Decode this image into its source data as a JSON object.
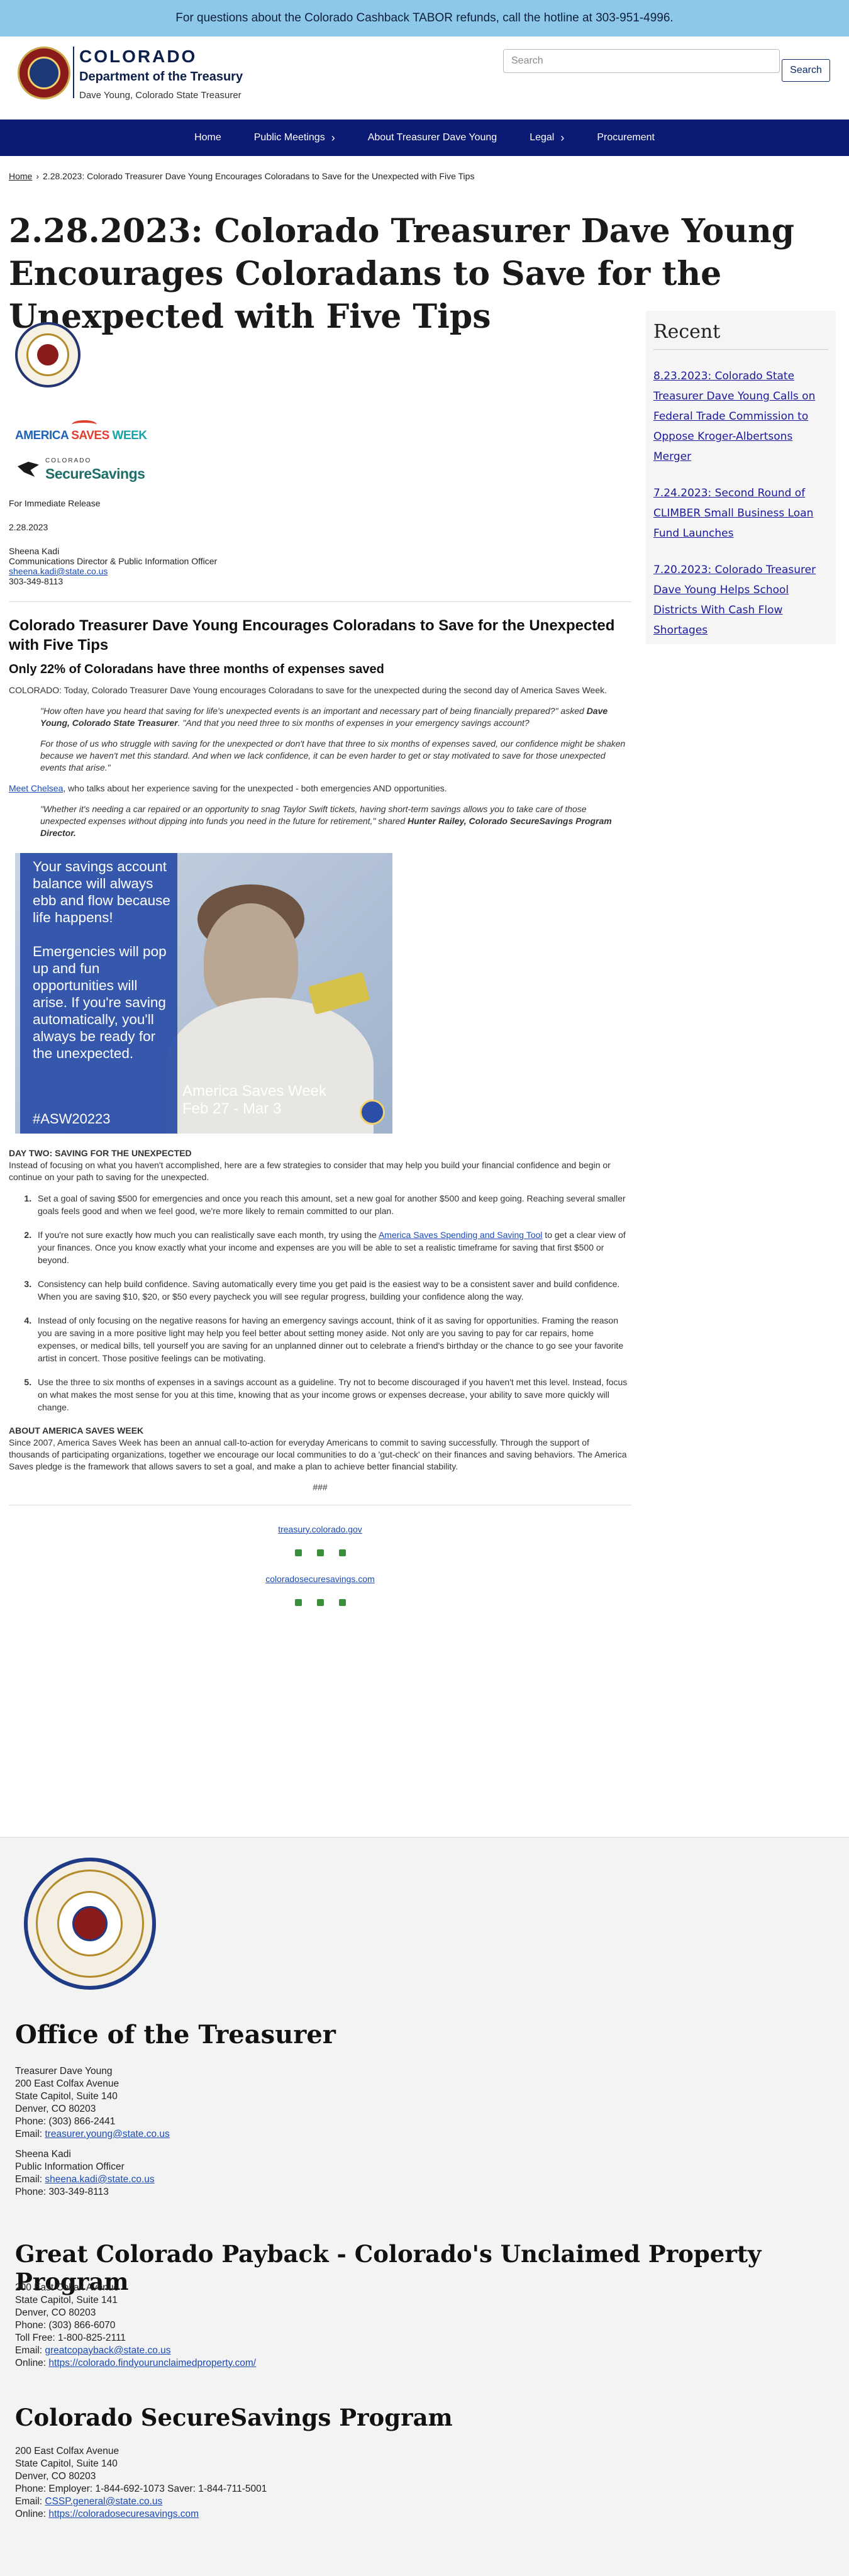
{
  "alert": {
    "text": "For questions about the Colorado Cashback TABOR refunds, call the hotline at 303-951-4996."
  },
  "brand": {
    "state": "COLORADO",
    "dept": "Department of the Treasury",
    "sub": "Dave Young, Colorado State Treasurer"
  },
  "search": {
    "placeholder": "Search",
    "button": "Search"
  },
  "nav": {
    "items": [
      "Home",
      "Public Meetings",
      "About Treasurer Dave Young",
      "Legal",
      "Procurement"
    ],
    "chevron": "›"
  },
  "breadcrumb": {
    "home": "Home",
    "separator": "›",
    "current": "2.28.2023: Colorado Treasurer Dave Young Encourages Coloradans to Save for the Unexpected with Five Tips"
  },
  "page": {
    "title": "2.28.2023: Colorado Treasurer Dave Young Encourages Coloradans to Save for the Unexpected with Five Tips"
  },
  "logos": {
    "asw_a": "AMERICA",
    "asw_b": " SAVES ",
    "asw_c": "WEEK",
    "css_top": "COLORADO",
    "css_main": "SecureSavings"
  },
  "release": {
    "label": "For Immediate Release",
    "date": "2.28.2023",
    "contact_name": "Sheena Kadi",
    "contact_title": "Communications Director & Public Information Officer",
    "contact_email": "sheena.kadi@state.co.us",
    "contact_phone": "303-349-8113"
  },
  "article": {
    "heading": "Colorado Treasurer Dave Young Encourages Coloradans to Save for the Unexpected with Five Tips",
    "subheading": "Only 22% of Coloradans have three months of expenses saved",
    "intro": "COLORADO: Today, Colorado Treasurer Dave Young encourages Coloradans to save for the unexpected during the second day of America Saves Week.",
    "quote1_text": "\"How often have you heard that saving for life's unexpected events is an important and necessary part of being financially prepared?\" asked ",
    "quote1_name": "Dave Young, Colorado State Treasurer",
    "quote1_after": ". \"And that you need three to six months of expenses in your emergency savings account?",
    "quote2": "For those of us who struggle with saving for the unexpected or don't have that three to six months of expenses saved, our confidence might be shaken because we haven't met this standard. And when we lack confidence, it can be even harder to get or stay motivated to save for those unexpected events that arise.\"",
    "chelsea_link": "Meet Chelsea",
    "chelsea_text": ", who talks about her experience saving for the unexpected - both emergencies AND opportunities.",
    "quote3_text": "\"Whether it's needing a car repaired or an opportunity to snag Taylor Swift tickets, having short-term savings allows you to take care of those unexpected expenses without dipping into funds you need in the future for retirement,\" shared ",
    "quote3_name": "Hunter Railey, Colorado SecureSavings Program Director.",
    "promo_msg1": "Your savings account balance will always ebb and flow because life happens!",
    "promo_msg2": "Emergencies will pop up and fun opportunities will arise. If you're saving automatically, you'll always be ready for the unexpected.",
    "promo_tag": "#ASW20223",
    "promo_asw": "America Saves Week",
    "promo_dates": "Feb 27 - Mar 3",
    "day_two_heading": "DAY TWO: SAVING FOR THE UNEXPECTED",
    "day_two_text": "Instead of focusing on what you haven't accomplished, here are a few strategies to consider that may help you build your financial confidence and begin or continue on your path to saving for the unexpected.",
    "tip1": "Set a goal of saving $500 for emergencies and once you reach this amount, set a new goal for another $500 and keep going. Reaching several smaller goals feels good and when we feel good, we're more likely to remain committed to our plan.",
    "tip2_a": "If you're not sure exactly how much you can realistically save each month, try using the ",
    "tip2_link": "America Saves Spending and Saving Tool",
    "tip2_b": " to get a clear view of your finances. Once you know exactly what your income and expenses are you will be able to set a realistic timeframe for saving that first $500 or beyond.",
    "tip3": "Consistency can help build confidence. Saving automatically every time you get paid is the easiest way to be a consistent saver and build confidence. When you are saving $10, $20, or $50 every paycheck you will see regular progress, building your confidence along the way.",
    "tip4": "Instead of only focusing on the negative reasons for having an emergency savings account, think of it as saving for opportunities. Framing the reason you are saving in a more positive light may help you feel better about setting money aside. Not only are you saving to pay for car repairs, home expenses, or medical bills, tell yourself you are saving for an unplanned dinner out to celebrate a friend's birthday or the chance to go see your favorite artist in concert. Those positive feelings can be motivating.",
    "tip5": "Use the three to six months of expenses in a savings account as a guideline. Try not to become discouraged if you haven't met this level. Instead, focus on what makes the most sense for you at this time, knowing that as your income grows or expenses decrease, your ability to save more quickly will change.",
    "about_heading": "ABOUT AMERICA SAVES WEEK",
    "about_text": "Since 2007, America Saves Week has been an annual call-to-action for everyday Americans to commit to saving successfully. Through the support of thousands of participating organizations, together we encourage our local communities to do a 'gut-check' on their finances and saving behaviors. The America Saves pledge is the framework that allows savers to set a goal, and make a plan to achieve better financial stability.",
    "end_mark": "###",
    "link1": "treasury.colorado.gov",
    "link2": "coloradosecuresavings.com"
  },
  "sidebar": {
    "heading": "Recent",
    "items": [
      "8.23.2023: Colorado State Treasurer Dave Young Calls on Federal Trade Commission to Oppose Kroger-Albertsons Merger",
      "7.24.2023: Second Round of CLIMBER Small Business Loan Fund Launches",
      "7.20.2023: Colorado Treasurer Dave Young Helps School Districts With Cash Flow Shortages"
    ]
  },
  "footer": {
    "office_heading": "Office of the Treasurer",
    "office_lines": [
      "Treasurer Dave Young",
      "200 East Colfax Avenue",
      "State Capitol, Suite 140",
      "Denver, CO 80203",
      "Phone: (303) 866-2441"
    ],
    "office_email_label": "Email: ",
    "office_email": "treasurer.young@state.co.us",
    "pio_lines": [
      "Sheena Kadi",
      "Public Information Officer"
    ],
    "pio_email_label": "Email: ",
    "pio_email": "sheena.kadi@state.co.us",
    "pio_phone": "Phone: 303-349-8113",
    "payback_heading": "Great Colorado Payback - Colorado's Unclaimed Property Program",
    "payback_lines": [
      "200 East Colfax Avenue",
      "State Capitol, Suite 141",
      "Denver, CO 80203",
      "Phone: (303) 866-6070",
      "Toll Free:  1-800-825-2111"
    ],
    "payback_email_label": "Email: ",
    "payback_email": "greatcopayback@state.co.us",
    "payback_online_label": "Online: ",
    "payback_online": "https://colorado.findyourunclaimedproperty.com/",
    "css_heading": "Colorado SecureSavings Program",
    "css_lines": [
      "200 East Colfax Avenue",
      "State Capitol, Suite 140",
      "Denver, CO 80203",
      "Phone: Employer: 1-844-692-1073  Saver: 1-844-711-5001"
    ],
    "css_email_label": "Email: ",
    "css_email": "CSSP.general@state.co.us",
    "css_online_label": "Online: ",
    "css_online": "https://coloradosecuresavings.com"
  }
}
